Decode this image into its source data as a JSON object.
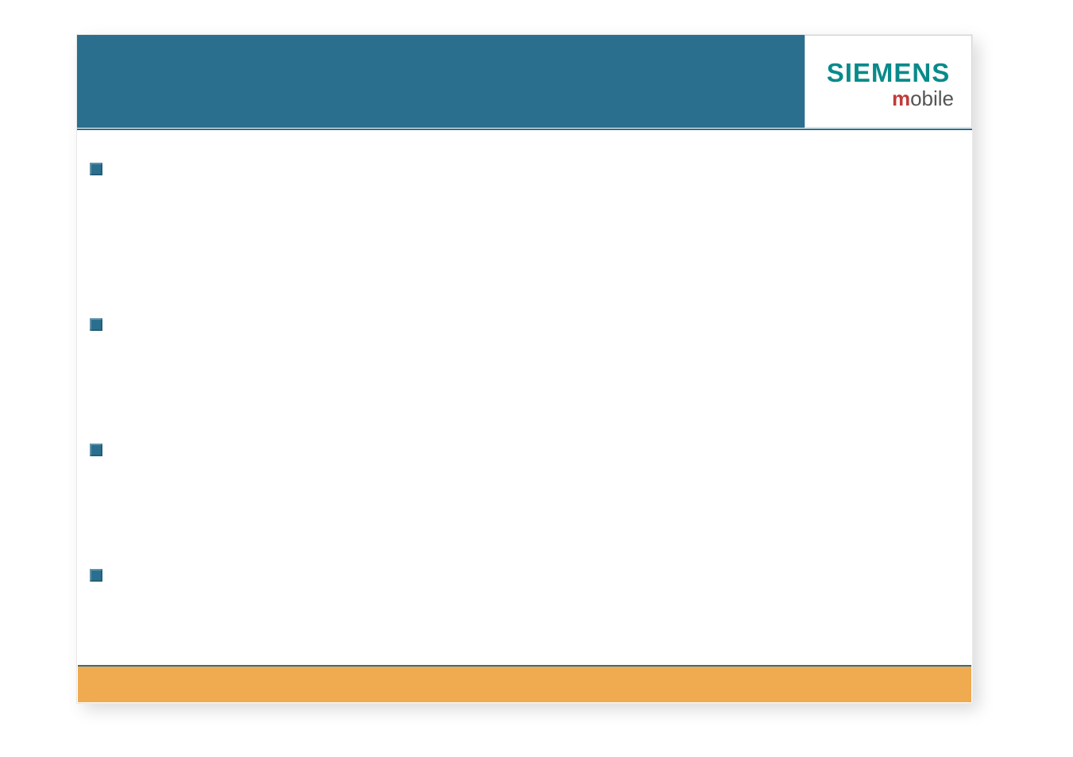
{
  "logo": {
    "main": "SIEMENS",
    "sub_prefix": "m",
    "sub_rest": "obile"
  },
  "colors": {
    "band": "#2b6f8e",
    "footer": "#f0aa4f",
    "logo_teal": "#0a8a8a",
    "logo_red_m": "#c23a3a"
  },
  "slide": {
    "title": "",
    "bullets": [
      "",
      "",
      "",
      ""
    ]
  }
}
